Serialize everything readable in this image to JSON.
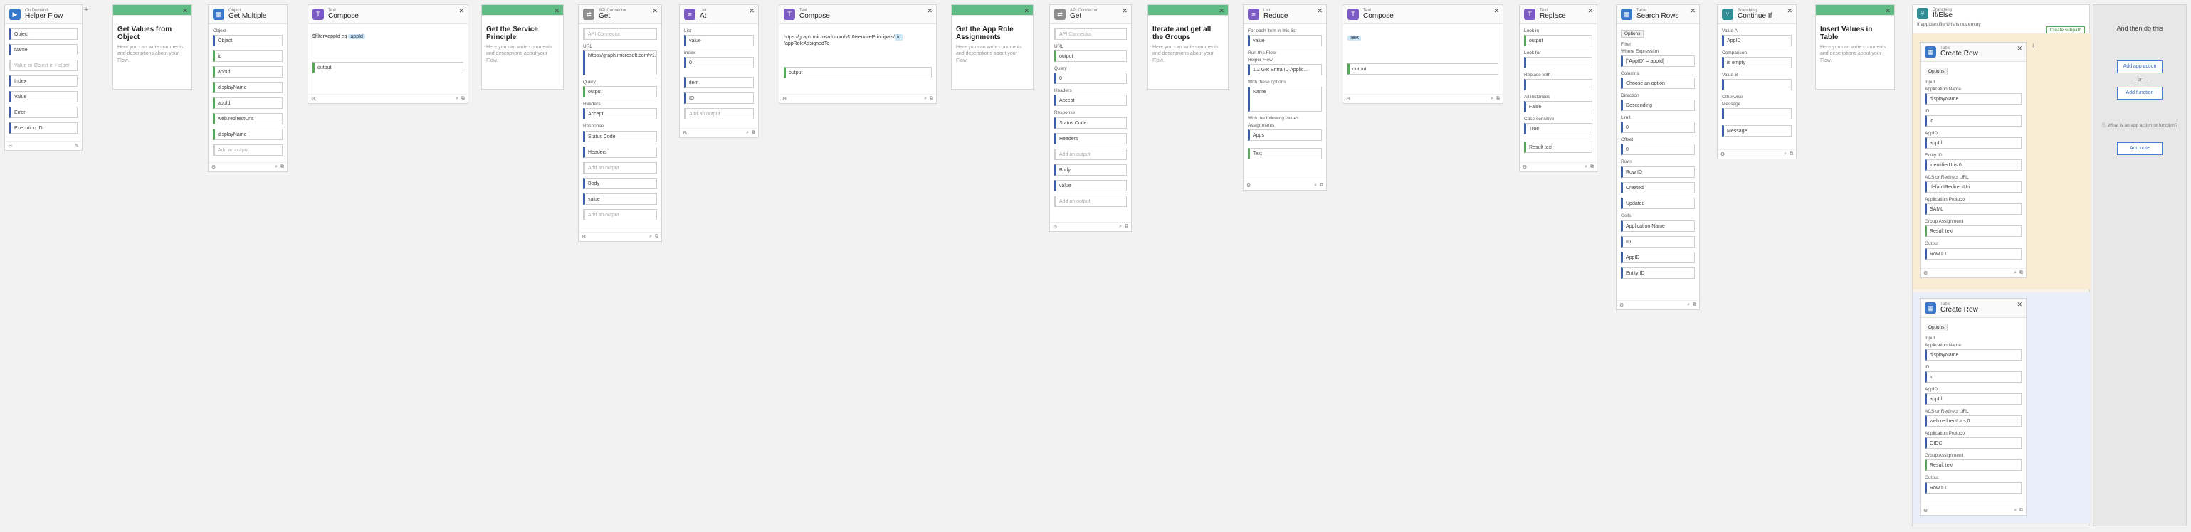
{
  "app": {
    "accent": "#5ebd84",
    "primary": "#3a78c9"
  },
  "cards": [
    {
      "id": "helper",
      "subtitle": "On Demand",
      "title": "Helper Flow",
      "fields": [
        "Object",
        "Name",
        "Value or Object in Helper",
        "Index",
        "Value",
        "Error",
        "Execution ID"
      ]
    },
    {
      "id": "note1",
      "title": "Get Values from Object",
      "text": "Here you can write comments and descriptions about your Flow."
    },
    {
      "id": "getmultiple",
      "subtitle": "Object",
      "title": "Get Multiple",
      "label": "Object",
      "value": "Object",
      "fields": [
        "id",
        "appId",
        "displayName",
        "appId",
        "web.redirectUris",
        "displayName",
        "Add an output"
      ]
    },
    {
      "id": "compose1",
      "subtitle": "Text",
      "title": "Compose",
      "text": "$filter=appId eq",
      "pill": "appId",
      "output": "output"
    },
    {
      "id": "note2",
      "title": "Get the Service Principle",
      "text": "Here you can write comments and descriptions about your Flow."
    },
    {
      "id": "api1",
      "subtitle": "API Connector",
      "title": "Get",
      "connector": "API Connector",
      "url_label": "URL",
      "url": "https://graph.microsoft.com/v1.0/servicePrincipals",
      "query_label": "Query",
      "query": "output",
      "headers_label": "Headers",
      "headers": "Accept",
      "response": "Response",
      "resp_fields": [
        "Status Code",
        "Headers",
        "Add an output",
        "Body",
        "value",
        "Add an output"
      ]
    },
    {
      "id": "at",
      "subtitle": "List",
      "title": "At",
      "list_label": "List",
      "list": "value",
      "index_label": "Index",
      "index": "0",
      "outputs": [
        "item",
        "ID",
        "Add an output"
      ]
    },
    {
      "id": "compose2",
      "subtitle": "Text",
      "title": "Compose",
      "text": "https://graph.microsoft.com/v1.0/servicePrincipals/",
      "pill": "id",
      "text2": "/appRoleAssignedTo",
      "output": "output"
    },
    {
      "id": "note3",
      "title": "Get the App Role Assignments",
      "text": "Here you can write comments and descriptions about your Flow."
    },
    {
      "id": "api2",
      "subtitle": "API Connector",
      "title": "Get",
      "connector": "API Connector",
      "url_label": "URL",
      "url": "output",
      "query_label": "Query",
      "query": "0",
      "headers_label": "Headers",
      "headers": "Accept",
      "response": "Response",
      "resp_fields": [
        "Status Code",
        "Headers",
        "Add an output",
        "Body",
        "value",
        "Add an output"
      ]
    },
    {
      "id": "note4",
      "title": "Iterate and get all the Groups",
      "text": "Here you can write comments and descriptions about your Flow."
    },
    {
      "id": "reduce",
      "subtitle": "List",
      "title": "Reduce",
      "for_each": "For each item in this list",
      "list": "value",
      "run_label": "Run this Flow",
      "helper": "Helper Flow",
      "helper_value": "1.2 Get Entra ID Applic...",
      "options": "With these options",
      "options_val": "Name",
      "inputs_label": "With the following values",
      "input_name": "Assignments",
      "input_value": "Apps",
      "output": "Text"
    },
    {
      "id": "compose3",
      "subtitle": "Text",
      "title": "Compose",
      "text": "Text",
      "output": "output"
    },
    {
      "id": "replace",
      "subtitle": "Text",
      "title": "Replace",
      "in_label": "Look in",
      "in_val": "output",
      "for_label": "Look for",
      "for_val": "",
      "with_label": "Replace with",
      "with_val": "",
      "all_label": "All instances",
      "all_val": "False",
      "case_label": "Case sensitive",
      "case_val": "True",
      "output": "Result text"
    },
    {
      "id": "search",
      "subtitle": "Table",
      "title": "Search Rows",
      "options": "Options",
      "filter": "Filter",
      "where": "Where Expression",
      "where_val": "[\"AppID\" = appId]",
      "columns": "Columns",
      "columns_val": "Choose an option",
      "direction": "Direction",
      "direction_val": "Descending",
      "limit": "Limit",
      "limit_val": "0",
      "offset": "Offset",
      "offset_val": "0",
      "rows": "Rows",
      "row_fields": [
        "Row ID",
        "Created",
        "Updated"
      ],
      "cells": "Cells",
      "cell_fields": [
        "Application Name",
        "ID",
        "AppID",
        "Entity ID"
      ]
    },
    {
      "id": "continue",
      "subtitle": "Branching",
      "title": "Continue If",
      "value_a": "Value A",
      "value_a_val": "AppID",
      "comparison": "Comparison",
      "comparison_val": "is empty",
      "value_b": "Value B",
      "otherwise": "Otherwise",
      "message": "Message",
      "output": "Message"
    },
    {
      "id": "note5",
      "title": "Insert Values in Table",
      "text": "Here you can write comments and descriptions about your Flow."
    }
  ],
  "loop": {
    "subtitle": "Branching",
    "title": "If/Else",
    "condition": "If appIdentifierUris is not empty",
    "create_subpath": "Create subpath",
    "top": {
      "subtitle": "Table",
      "title": "Create Row",
      "options": "Options",
      "input": "Input",
      "fields": [
        {
          "label": "Application Name",
          "value": "displayName"
        },
        {
          "label": "ID",
          "value": "id"
        },
        {
          "label": "AppID",
          "value": "appId"
        },
        {
          "label": "Entity ID",
          "value": "identifierUris.0"
        },
        {
          "label": "ACS or Redirect URL",
          "value": "defaultRedirectUri"
        },
        {
          "label": "Application Protocol",
          "value": "SAML"
        },
        {
          "label": "Group Assignment",
          "value": "Result text"
        }
      ],
      "output": "Output",
      "row_id": "Row ID"
    },
    "bottom": {
      "subtitle": "Table",
      "title": "Create Row",
      "options": "Options",
      "input": "Input",
      "fields": [
        {
          "label": "Application Name",
          "value": "displayName"
        },
        {
          "label": "ID",
          "value": "id"
        },
        {
          "label": "AppID",
          "value": "appId"
        },
        {
          "label": "ACS or Redirect URL",
          "value": "web.redirectUris.0"
        },
        {
          "label": "Application Protocol",
          "value": "OIDC"
        },
        {
          "label": "Group Assignment",
          "value": "Result text"
        }
      ],
      "output": "Output",
      "row_id": "Row ID"
    }
  },
  "side_panel": {
    "title": "And then do this",
    "add_app": "Add app action",
    "or": "— or —",
    "add_function": "Add function",
    "hint": "What is an app action or function?",
    "add_note": "Add note"
  }
}
